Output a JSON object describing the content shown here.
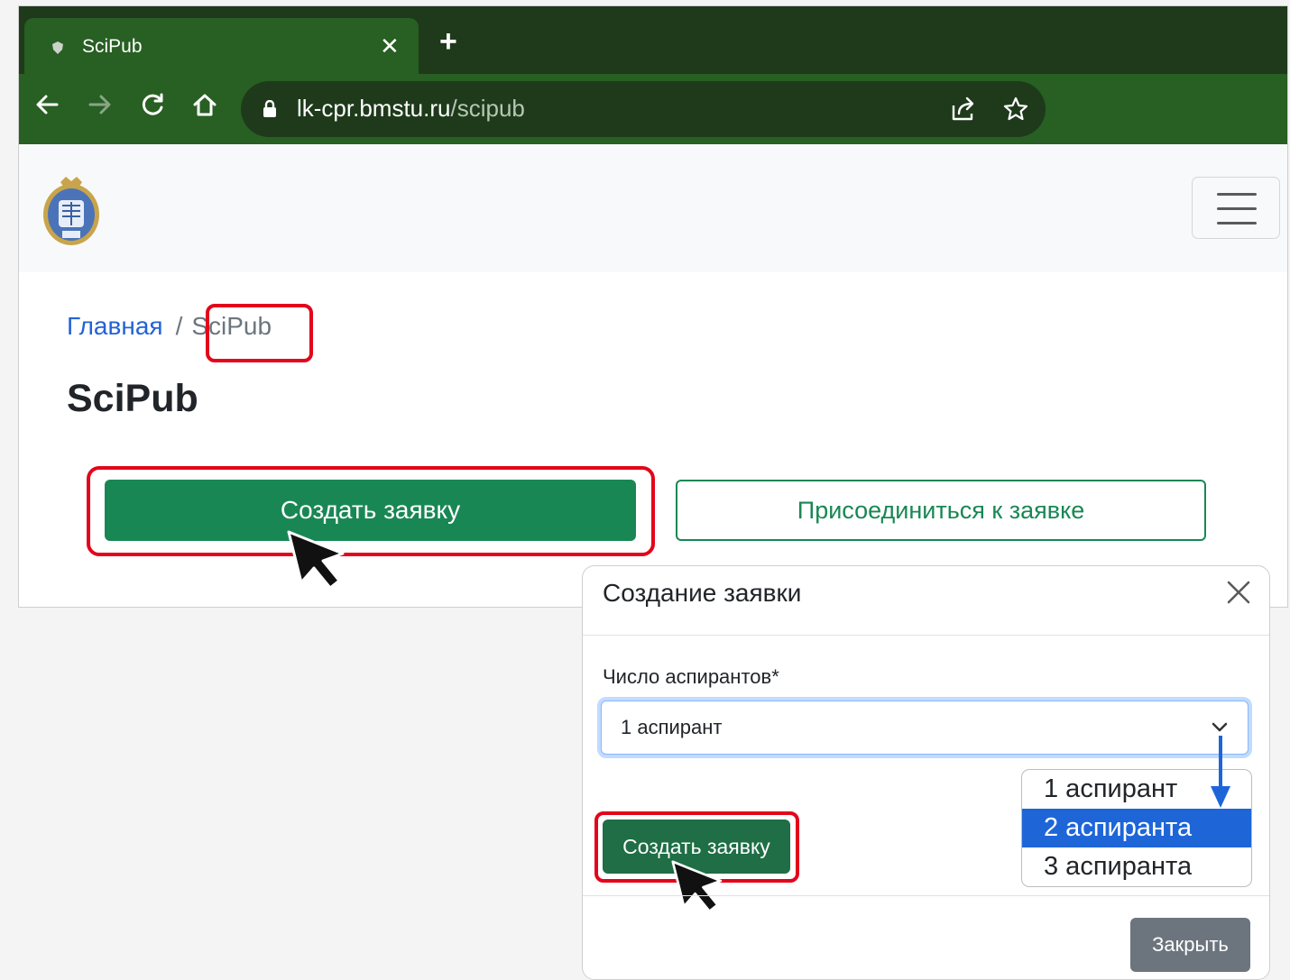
{
  "browser": {
    "tab_title": "SciPub",
    "tab_close": "✕",
    "new_tab": "+",
    "url_host": "lk-cpr.bmstu.ru",
    "url_path": "/scipub"
  },
  "breadcrumb": {
    "home": "Главная",
    "separator": "/",
    "current": "SciPub"
  },
  "page": {
    "title": "SciPub",
    "create_button": "Создать заявку",
    "join_button": "Присоединиться к заявке"
  },
  "modal": {
    "title": "Создание заявки",
    "field_label": "Число аспирантов*",
    "selected_value": "1 аспирант",
    "options": [
      "1 аспирант",
      "2 аспиранта",
      "3 аспиранта"
    ],
    "highlighted_option": "2 аспиранта",
    "create_button": "Создать заявку",
    "close_button": "Закрыть"
  },
  "colors": {
    "browser_frame": "#285f23",
    "browser_tabstrip": "#1e3a1b",
    "primary_green": "#198754",
    "link_blue": "#2462d6",
    "highlight_red": "#e3051b",
    "dropdown_selected": "#1e66d8",
    "secondary_gray": "#6c757d"
  },
  "icons": [
    "shield-favicon-icon",
    "close-icon",
    "plus-icon",
    "back-arrow-icon",
    "forward-arrow-icon",
    "reload-icon",
    "home-icon",
    "lock-icon",
    "share-icon",
    "star-icon",
    "university-emblem-logo",
    "hamburger-menu-icon",
    "chevron-down-icon",
    "mouse-cursor-icon",
    "down-arrow-annotation-icon"
  ]
}
